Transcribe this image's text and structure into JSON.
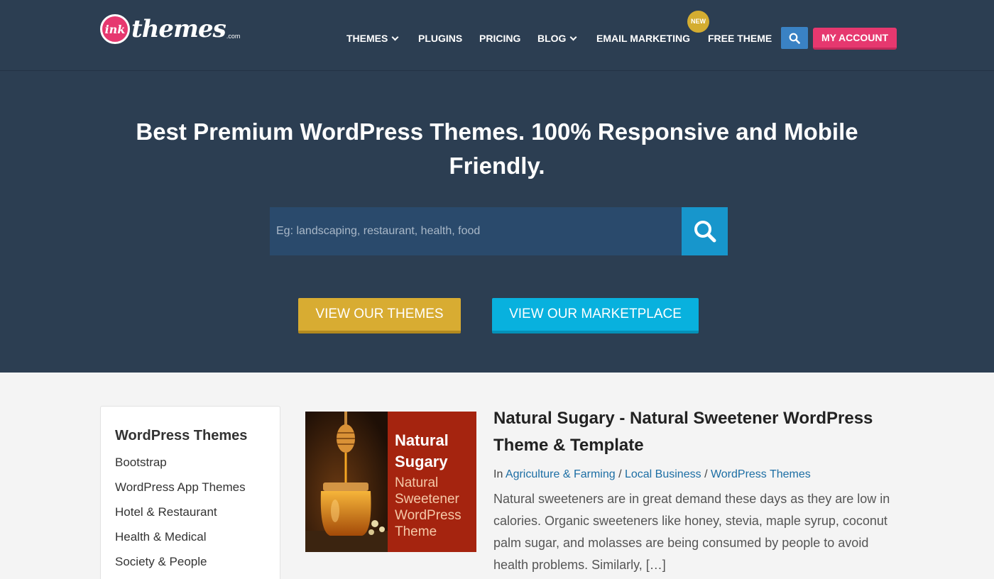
{
  "header": {
    "logo": {
      "mark": "ink",
      "name": "themes",
      "tld": ".com"
    },
    "nav": [
      {
        "label": "THEMES",
        "has_dropdown": true
      },
      {
        "label": "PLUGINS",
        "has_dropdown": false
      },
      {
        "label": "PRICING",
        "has_dropdown": false
      },
      {
        "label": "BLOG",
        "has_dropdown": true
      },
      {
        "label": "EMAIL MARKETING",
        "has_dropdown": false
      },
      {
        "label": "FREE THEME",
        "has_dropdown": false
      }
    ],
    "new_badge": "NEW",
    "search_icon": "search-icon",
    "account_label": "MY ACCOUNT"
  },
  "hero": {
    "title": "Best Premium WordPress Themes. 100% Responsive and Mobile Friendly.",
    "search_placeholder": "Eg: landscaping, restaurant, health, food",
    "search_icon": "search-icon",
    "cta_themes": "VIEW OUR THEMES",
    "cta_marketplace": "VIEW OUR MARKETPLACE"
  },
  "sidebar": {
    "title": "WordPress Themes",
    "items": [
      "Bootstrap",
      "WordPress App Themes",
      "Hotel & Restaurant",
      "Health & Medical",
      "Society & People"
    ]
  },
  "post": {
    "thumbnail_text": [
      "Natural",
      "Sugary",
      "Natural",
      "Sweetener",
      "WordPress",
      "Theme"
    ],
    "title": "Natural Sugary - Natural Sweetener WordPress Theme & Template",
    "meta_prefix": "In",
    "categories": [
      "Agriculture & Farming",
      "Local Business",
      "WordPress Themes"
    ],
    "separator": "/",
    "excerpt": "Natural sweeteners are in great demand these days as they are low in calories. Organic sweeteners like honey, stevia, maple syrup, coconut palm sugar, and molasses are being consumed by people to avoid health problems. Similarly, […]"
  },
  "colors": {
    "header_bg": "#2c3e52",
    "accent_pink": "#e6386f",
    "accent_blue": "#3a82c4",
    "cta_gold": "#d8ac32",
    "cta_cyan": "#08b1de",
    "link": "#1c6ea4"
  }
}
